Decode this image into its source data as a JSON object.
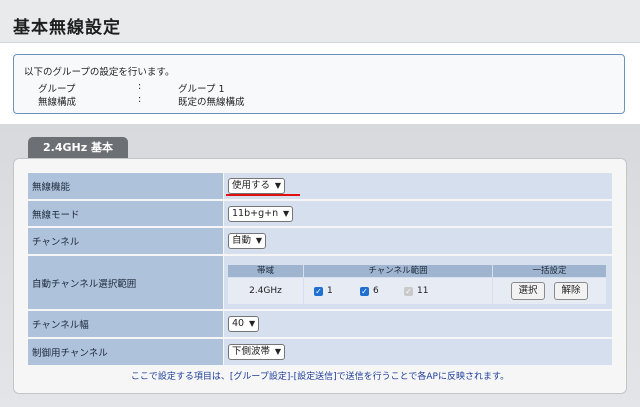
{
  "page_title": "基本無線設定",
  "info": {
    "intro": "以下のグループの設定を行います。",
    "rows": [
      {
        "label": "グループ",
        "sep": ":",
        "value": "グループ 1"
      },
      {
        "label": "無線構成",
        "sep": ":",
        "value": "既定の無線構成"
      }
    ]
  },
  "tab_label": "2.4GHz 基本",
  "rows": {
    "wireless_function": {
      "label": "無線機能",
      "value": "使用する"
    },
    "wireless_mode": {
      "label": "無線モード",
      "value": "11b+g+n"
    },
    "channel": {
      "label": "チャンネル",
      "value": "自動"
    },
    "auto_channel": {
      "label": "自動チャンネル選択範囲",
      "headers": {
        "band": "帯域",
        "range": "チャンネル範囲",
        "bulk": "一括設定"
      },
      "band_value": "2.4GHz",
      "channels": [
        {
          "label": "1",
          "checked": true,
          "disabled": false
        },
        {
          "label": "6",
          "checked": true,
          "disabled": false
        },
        {
          "label": "11",
          "checked": true,
          "disabled": true
        }
      ],
      "select_button": "選択",
      "clear_button": "解除"
    },
    "channel_width": {
      "label": "チャンネル幅",
      "value": "40"
    },
    "control_channel": {
      "label": "制御用チャンネル",
      "value": "下側波帯"
    }
  },
  "footnote": "ここで設定する項目は、[グループ設定]-[設定送信]で送信を行うことで各APに反映されます。",
  "colors": {
    "label_bg": "#aec2dc",
    "value_bg": "#d6dfee",
    "accent_red": "#e01010",
    "link_blue": "#1d3d9a"
  },
  "icons": {
    "dropdown": "chevron-down-icon",
    "checkbox": "checkmark-icon"
  }
}
